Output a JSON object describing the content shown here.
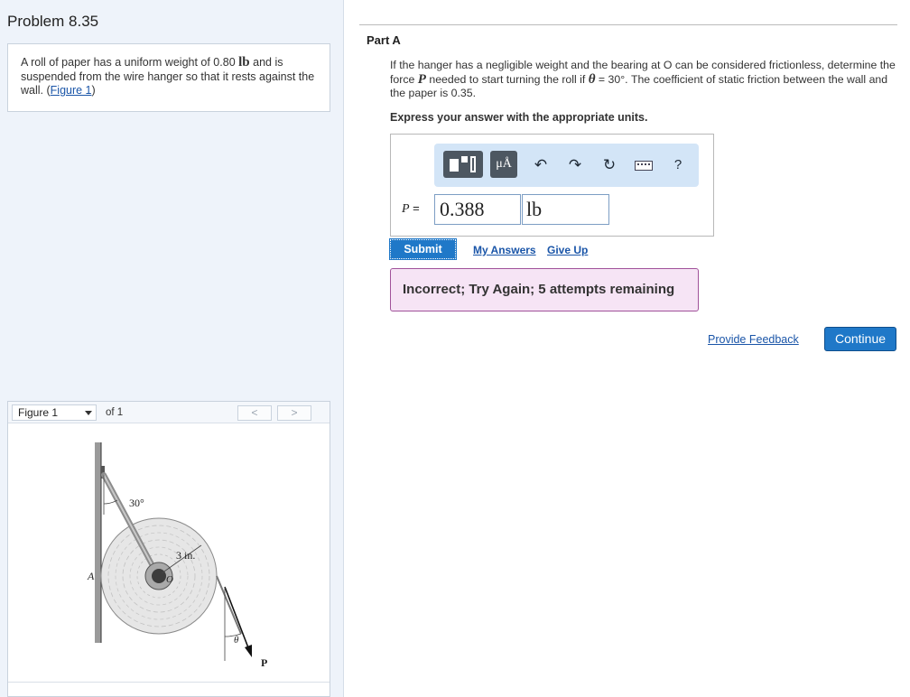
{
  "problem": {
    "title": "Problem 8.35",
    "text_before": "A roll of paper has a uniform weight of 0.80 ",
    "weight_unit": "lb",
    "text_after": " and is suspended from the wire hanger so that it rests against the wall. (",
    "figure_link": "Figure 1",
    "text_end": ")"
  },
  "figure": {
    "select_label": "Figure 1",
    "of_label": "of 1",
    "prev": "<",
    "next": ">",
    "labels": {
      "angle_top": "30°",
      "radius": "3 in.",
      "point_a": "A",
      "point_o": "O",
      "theta": "θ",
      "force": "P"
    }
  },
  "part": {
    "label": "Part A",
    "q1": "If the hanger has a negligible weight and the bearing at O can be considered frictionless, determine the force ",
    "q_var": "P",
    "q2": " needed to start turning the roll if ",
    "q_theta": "θ",
    "q3": " = 30°. The coefficient of static friction between the wall and the paper is 0.35.",
    "instruction": "Express your answer with the appropriate units."
  },
  "answer": {
    "units_button": "μÅ",
    "undo": "↶",
    "redo": "↷",
    "reset": "↻",
    "help": "?",
    "var_label": "P",
    "equals": " =",
    "value": "0.388",
    "unit": "lb"
  },
  "actions": {
    "submit": "Submit",
    "my_answers": "My Answers",
    "give_up": "Give Up"
  },
  "feedback": "Incorrect; Try Again; 5 attempts remaining",
  "footer": {
    "provide_feedback": "Provide Feedback",
    "continue": "Continue"
  }
}
